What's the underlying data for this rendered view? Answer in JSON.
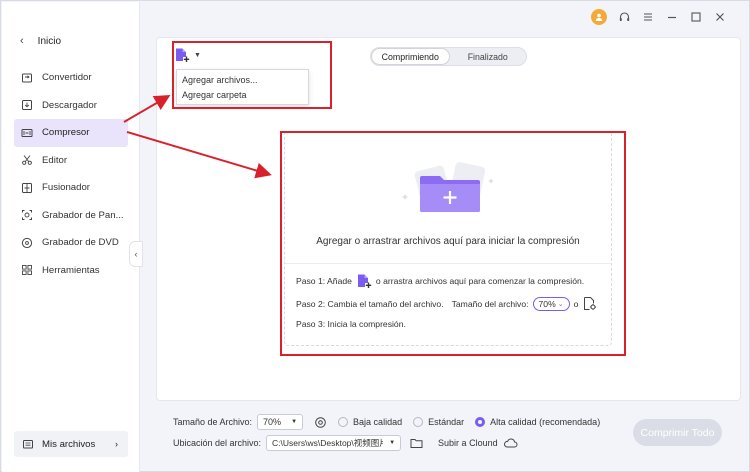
{
  "sidebar": {
    "back_label": "Inicio",
    "items": [
      {
        "label": "Convertidor",
        "icon": "convert-icon"
      },
      {
        "label": "Descargador",
        "icon": "download-icon"
      },
      {
        "label": "Compresor",
        "icon": "compress-icon",
        "active": true
      },
      {
        "label": "Editor",
        "icon": "scissors-icon"
      },
      {
        "label": "Fusionador",
        "icon": "merge-icon"
      },
      {
        "label": "Grabador de Pan...",
        "icon": "screen-record-icon"
      },
      {
        "label": "Grabador de DVD",
        "icon": "dvd-icon"
      },
      {
        "label": "Herramientas",
        "icon": "tools-grid-icon"
      }
    ],
    "my_files_label": "Mis archivos"
  },
  "toolbar": {
    "menu": [
      "Agregar archivos...",
      "Agregar carpeta"
    ],
    "tabs": [
      "Comprimiendo",
      "Finalizado"
    ]
  },
  "dropzone": {
    "prompt": "Agregar o arrastrar archivos aquí para iniciar la compresión",
    "step1_prefix": "Paso 1: Añade",
    "step1_suffix": "o arrastra archivos aquí para comenzar la compresión.",
    "step2_text": "Paso 2: Cambia el tamaño del archivo.",
    "step2_size_label": "Tamaño del archivo:",
    "step2_size_value": "70%",
    "step2_or": "o",
    "step3_text": "Paso 3: Inicia la compresión."
  },
  "bottom": {
    "file_size_label": "Tamaño de Archivo:",
    "file_size_value": "70%",
    "quality_low": "Baja calidad",
    "quality_std": "Estándar",
    "quality_high": "Alta calidad (recomendada)",
    "location_label": "Ubicación del archivo:",
    "location_value": "C:\\Users\\ws\\Desktop\\视频图片",
    "upload_label": "Subir a Clound",
    "compress_all": "Comprimir Todo"
  },
  "colors": {
    "accent": "#7b5cf0",
    "annotation": "#d8222b",
    "active_bg": "#e9e4fb"
  }
}
